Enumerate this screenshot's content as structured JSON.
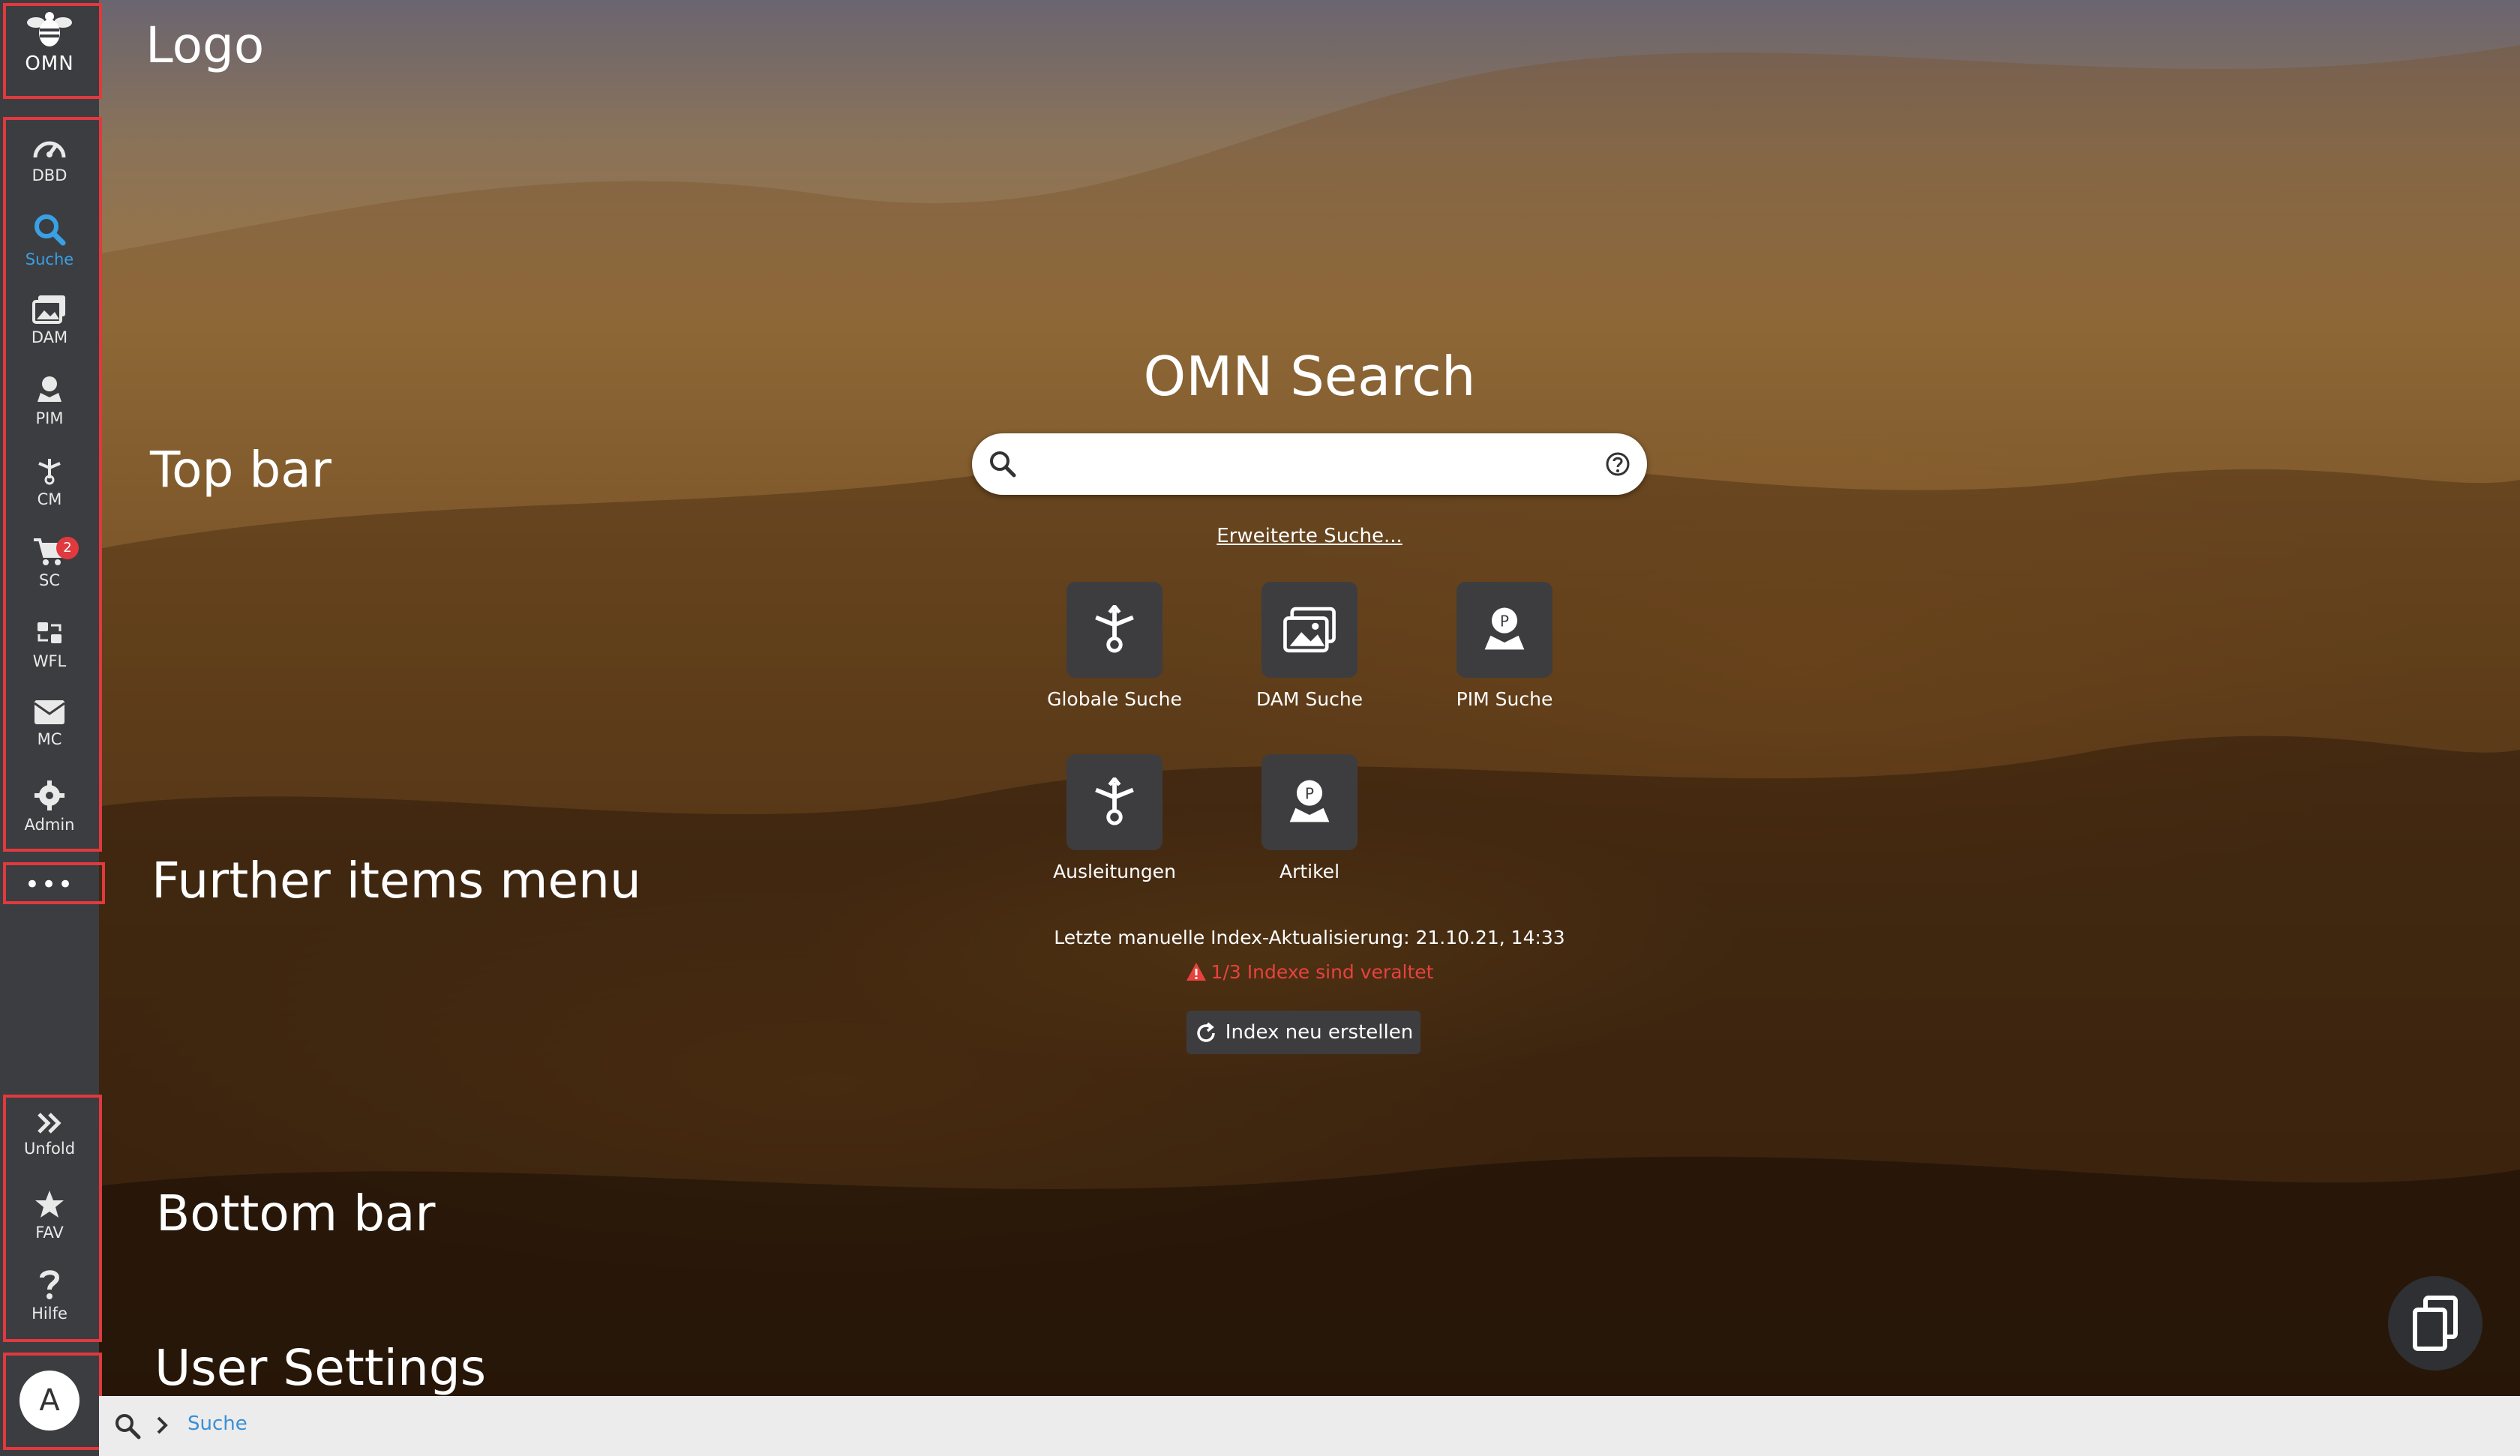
{
  "sidebar": {
    "logo_text": "OMN",
    "items": [
      {
        "label": "DBD",
        "icon": "dashboard-gauge-icon"
      },
      {
        "label": "Suche",
        "icon": "search-icon",
        "active": true
      },
      {
        "label": "DAM",
        "icon": "images-icon"
      },
      {
        "label": "PIM",
        "icon": "product-person-icon"
      },
      {
        "label": "CM",
        "icon": "channel-split-icon"
      },
      {
        "label": "SC",
        "icon": "shopping-cart-icon",
        "badge": "2"
      },
      {
        "label": "WFL",
        "icon": "workflow-icon"
      },
      {
        "label": "MC",
        "icon": "envelope-icon"
      },
      {
        "label": "Admin",
        "icon": "gear-admin-icon"
      }
    ],
    "more_label": "•••",
    "bottom_items": [
      {
        "label": "Unfold",
        "icon": "double-chevron-right-icon"
      },
      {
        "label": "FAV",
        "icon": "star-icon"
      },
      {
        "label": "Hilfe",
        "icon": "question-icon"
      }
    ],
    "avatar_letter": "A"
  },
  "annotations": {
    "logo": "Logo",
    "top_bar": "Top bar",
    "further_items": "Further items menu",
    "bottom_bar": "Bottom bar",
    "user_settings": "User Settings"
  },
  "search": {
    "title": "OMN Search",
    "value": "",
    "advanced_link": "Erweiterte Suche...",
    "tiles": [
      {
        "label": "Globale Suche",
        "icon": "channel-split-icon"
      },
      {
        "label": "DAM Suche",
        "icon": "images-icon"
      },
      {
        "label": "PIM Suche",
        "icon": "product-person-icon"
      },
      {
        "label": "Ausleitungen",
        "icon": "channel-split-icon"
      },
      {
        "label": "Artikel",
        "icon": "product-person-icon"
      }
    ],
    "index_date": "Letzte manuelle Index-Aktualisierung: 21.10.21, 14:33",
    "index_warning": "1/3 Indexe sind veraltet",
    "index_button": "Index neu erstellen"
  },
  "breadcrumb": {
    "current": "Suche"
  },
  "colors": {
    "sidebar_bg": "#3c3d40",
    "accent_blue": "#3aa0e6",
    "annotation_red": "#e0393e",
    "warning_red": "#e8423f"
  }
}
